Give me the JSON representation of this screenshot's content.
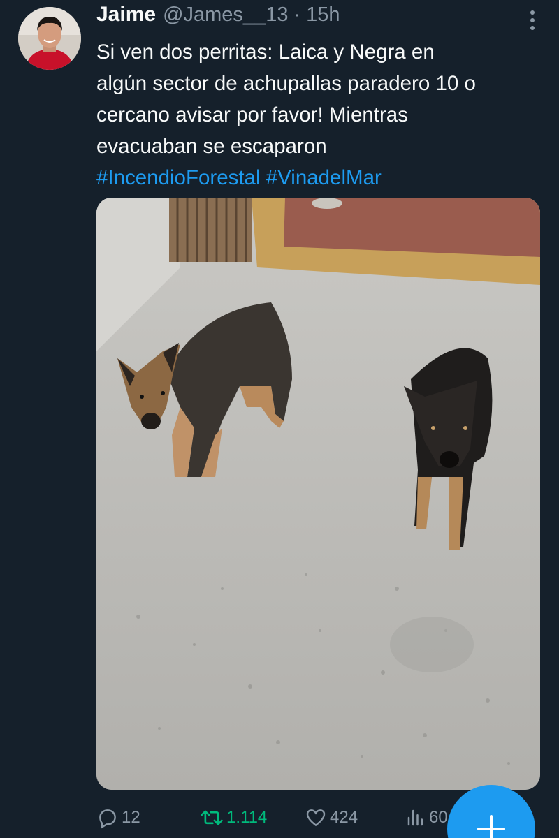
{
  "author": {
    "display_name": "Jaime",
    "handle": "@James__13",
    "separator": "·",
    "time": "15h",
    "avatar_icon": "avatar-photo"
  },
  "tweet": {
    "lines": [
      "Si ven dos perritas: Laica y Negra en",
      "algún sector de achupallas paradero 10 o",
      "cercano avisar por favor! Mientras",
      "evacuaban se escaparon"
    ],
    "hashtags": [
      "#IncendioForestal",
      "#VinadelMar"
    ]
  },
  "media": {
    "type": "photo",
    "icon": "dogs-photo"
  },
  "actions": {
    "replies": "12",
    "retweets": "1.114",
    "likes": "424",
    "views": "60"
  },
  "colors": {
    "background": "#15202b",
    "accent": "#1d9bf0",
    "retweet_green": "#00ba7c",
    "muted": "#8b98a5"
  }
}
